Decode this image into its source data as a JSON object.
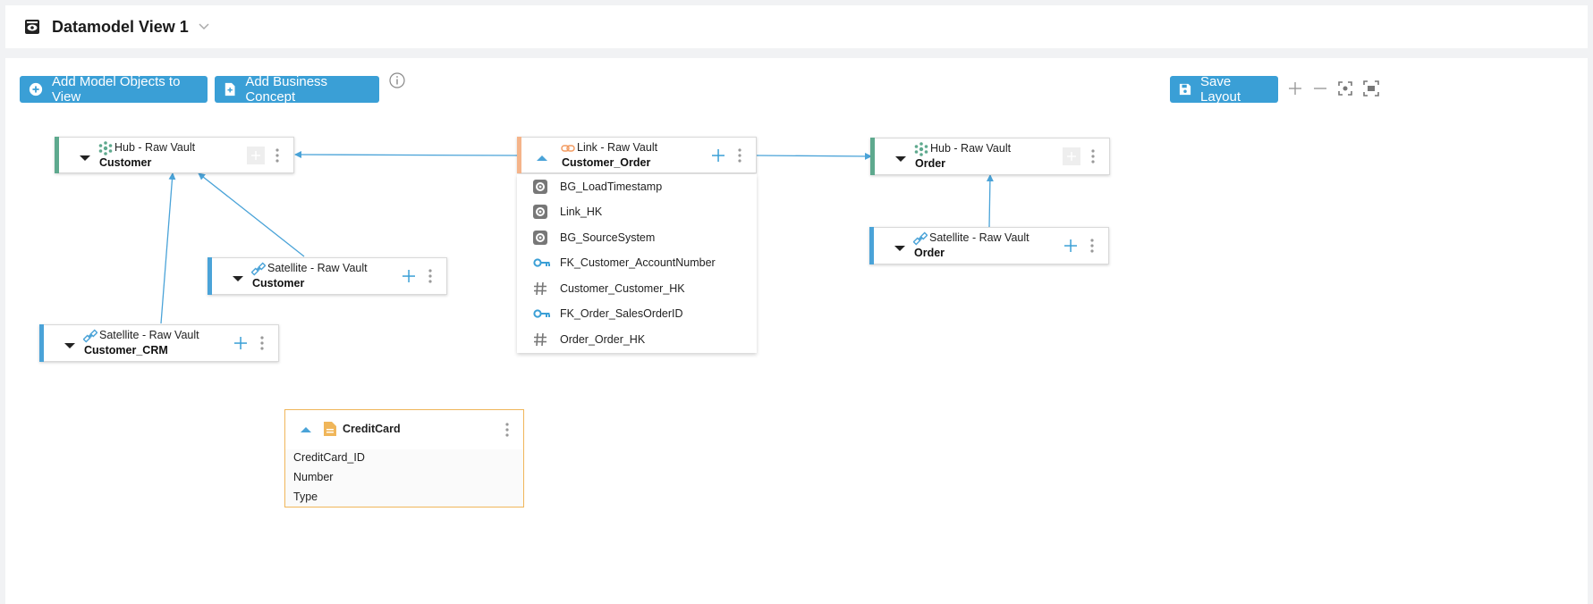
{
  "header": {
    "title": "Datamodel View 1",
    "icons": {
      "view": "eye-icon",
      "dropdown": "chevron-down-icon"
    }
  },
  "toolbar": {
    "add_objects_label": "Add Model Objects to View",
    "add_concept_label": "Add Business Concept",
    "save_layout_label": "Save Layout",
    "icons": [
      "plus-circle-icon",
      "document-plus-icon",
      "info-icon",
      "save-icon",
      "zoom-in-icon",
      "zoom-out-icon",
      "center-icon",
      "fit-screen-icon"
    ]
  },
  "colors": {
    "accent": "#3a9fd6",
    "hub": "#5ea98e",
    "satellite": "#4aa3d8",
    "link": "#f5b48a",
    "business_concept": "#f0b65a",
    "edge": "#4aa3d8"
  },
  "nodes": {
    "hub_customer": {
      "type": "Hub - Raw Vault",
      "name": "Customer"
    },
    "link_customer_order": {
      "type": "Link - Raw Vault",
      "name": "Customer_Order"
    },
    "hub_order": {
      "type": "Hub - Raw Vault",
      "name": "Order"
    },
    "sat_customer": {
      "type": "Satellite - Raw Vault",
      "name": "Customer"
    },
    "sat_order": {
      "type": "Satellite - Raw Vault",
      "name": "Order"
    },
    "sat_customer_crm": {
      "type": "Satellite - Raw Vault",
      "name": "Customer_CRM"
    }
  },
  "link_attributes": [
    {
      "name": "BG_LoadTimestamp",
      "icon": "gear-icon"
    },
    {
      "name": "Link_HK",
      "icon": "gear-icon"
    },
    {
      "name": "BG_SourceSystem",
      "icon": "gear-icon"
    },
    {
      "name": "FK_Customer_AccountNumber",
      "icon": "key-icon"
    },
    {
      "name": "Customer_Customer_HK",
      "icon": "hash-icon"
    },
    {
      "name": "FK_Order_SalesOrderID",
      "icon": "key-icon"
    },
    {
      "name": "Order_Order_HK",
      "icon": "hash-icon"
    }
  ],
  "business_concept": {
    "name": "CreditCard",
    "attributes": [
      "CreditCard_ID",
      "Number",
      "Type"
    ]
  }
}
